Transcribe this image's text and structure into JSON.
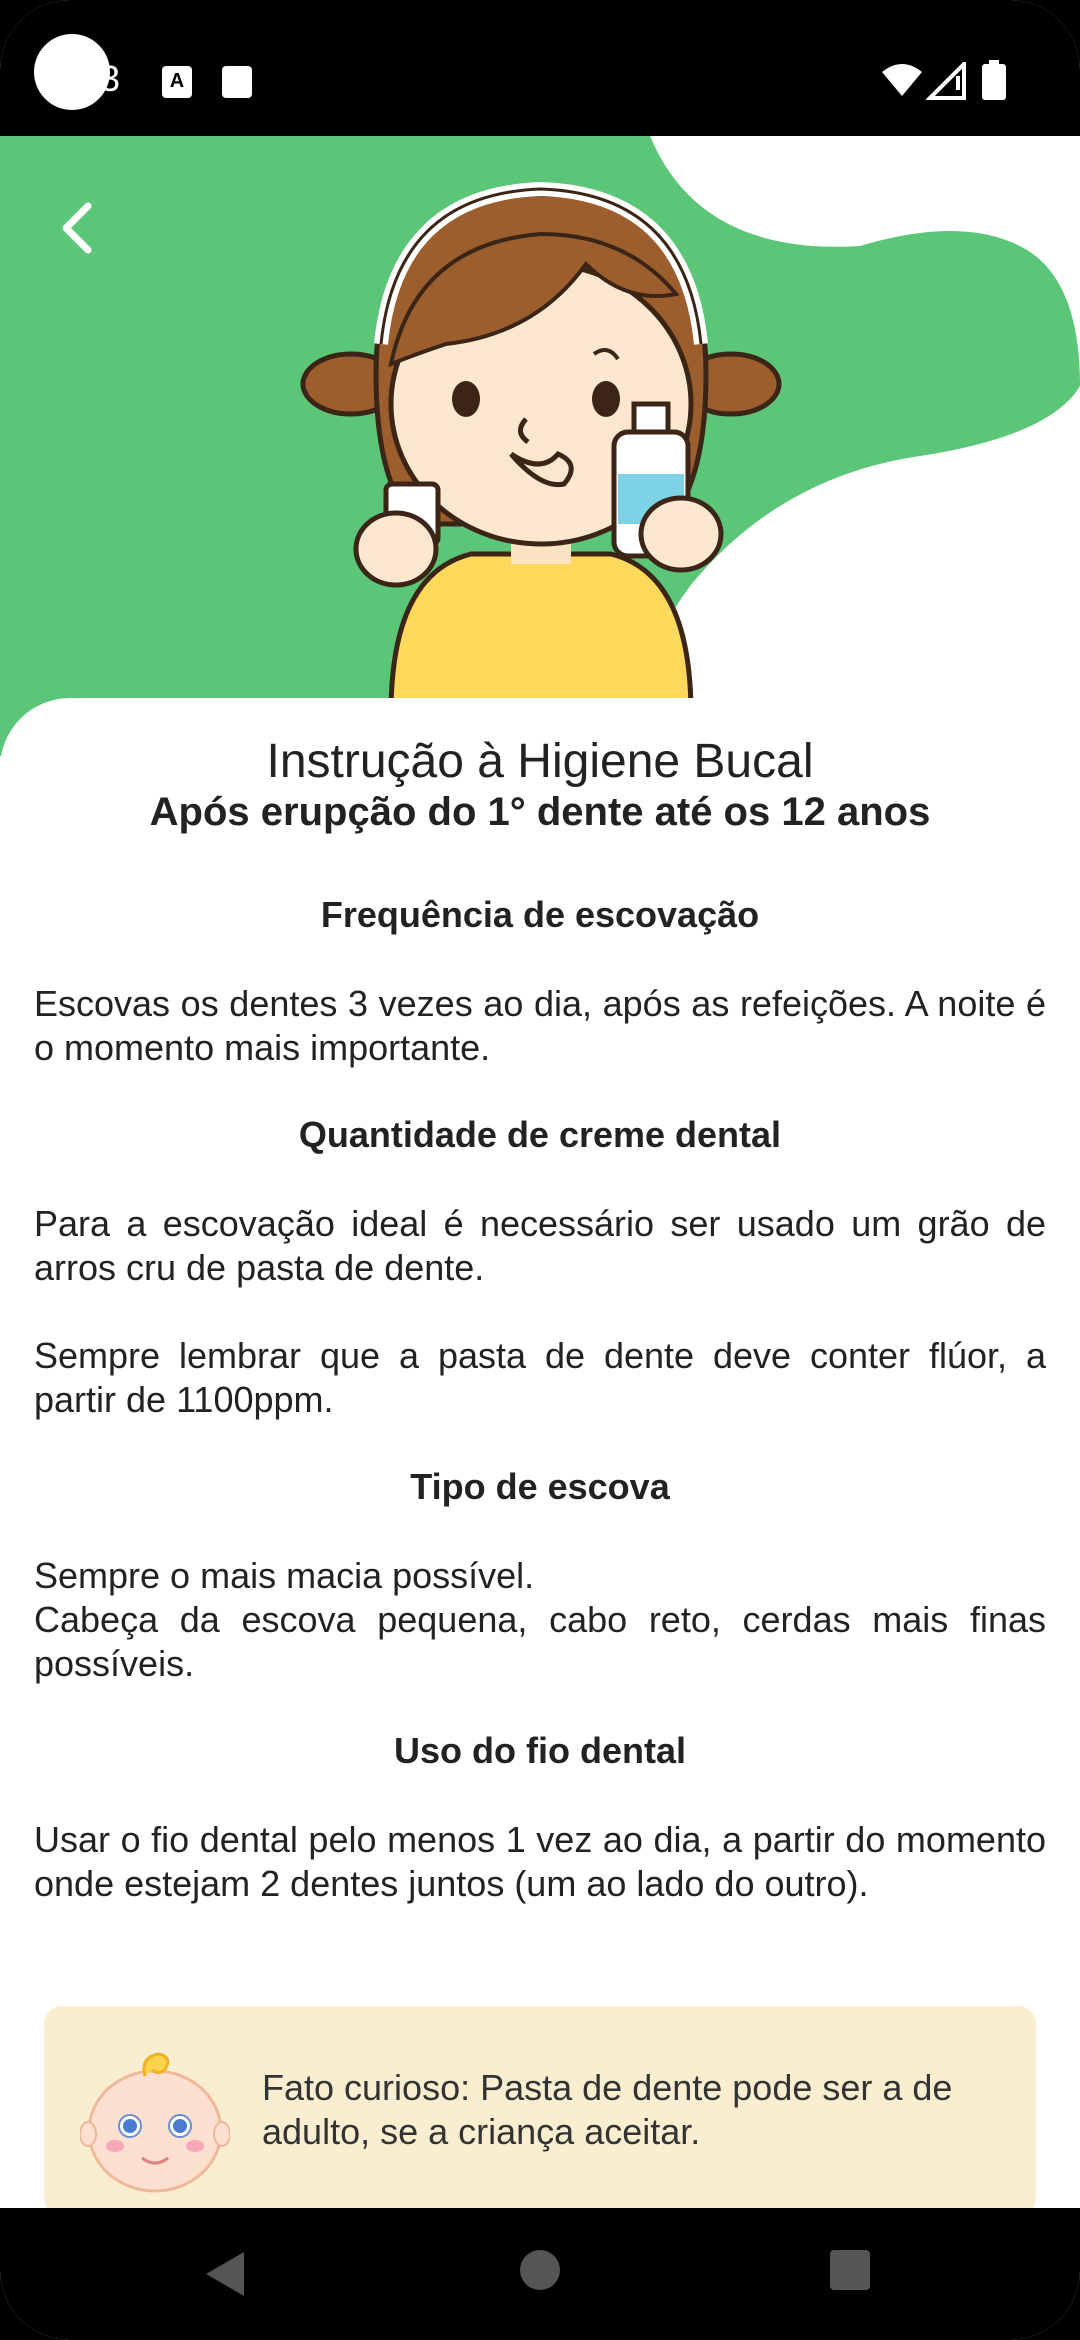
{
  "status_bar": {
    "time": "3"
  },
  "header": {
    "back_label": "back"
  },
  "content": {
    "title": "Instrução à Higiene Bucal",
    "subtitle": "Após erupção do 1° dente até os 12 anos",
    "sections": [
      {
        "heading": "Frequência de escovação",
        "paragraphs": [
          "Escovas os dentes 3 vezes ao dia, após as refeições. A noite é o momento mais importante."
        ]
      },
      {
        "heading": "Quantidade de creme dental",
        "paragraphs": [
          "Para a escovação ideal é necessário ser usado um grão de arros cru de pasta de dente.",
          "Sempre lembrar que a pasta de dente deve conter flúor, a partir de 1100ppm."
        ]
      },
      {
        "heading": "Tipo de escova",
        "paragraphs": [
          "Sempre o mais macia possível.",
          "Cabeça da escova pequena, cabo reto, cerdas mais finas possíveis."
        ]
      },
      {
        "heading": "Uso do fio dental",
        "paragraphs": [
          "Usar o fio dental pelo menos 1 vez ao dia, a partir do momento onde estejam 2 dentes juntos (um ao lado do outro)."
        ]
      }
    ],
    "fact": "Fato curioso: Pasta de dente pode ser a de adulto, se a criança aceitar."
  },
  "colors": {
    "accent_green": "#5cc678",
    "fact_bg": "#f9efd0"
  }
}
